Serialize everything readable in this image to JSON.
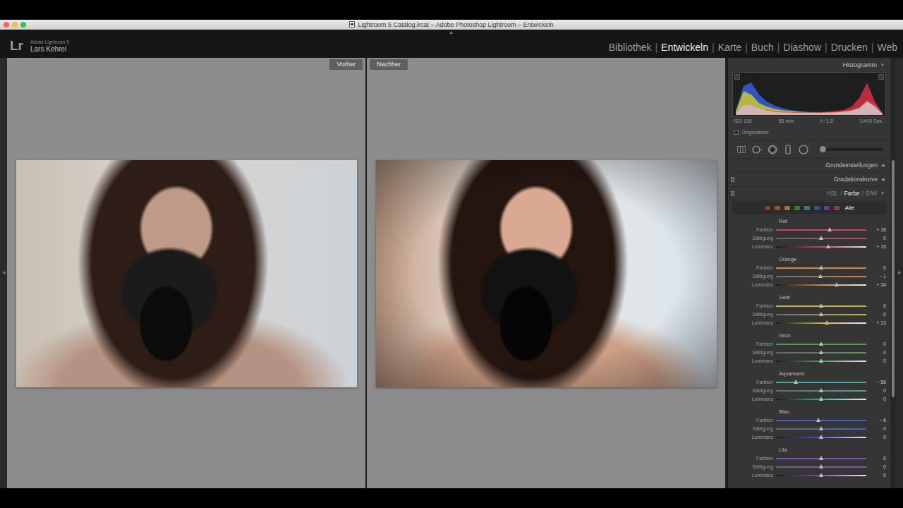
{
  "window": {
    "title": "Lightroom 5 Catalog.lrcat – Adobe Photoshop Lightroom – Entwickeln"
  },
  "app": {
    "logo": "Lr",
    "product": "Adobe Lightroom 5",
    "user": "Lars Kehrel"
  },
  "edges": {
    "top": "▲",
    "left": "◀",
    "right": "▶"
  },
  "module_separator": "|",
  "modules": [
    {
      "label": "Bibliothek",
      "selected": false
    },
    {
      "label": "Entwickeln",
      "selected": true
    },
    {
      "label": "Karte",
      "selected": false
    },
    {
      "label": "Buch",
      "selected": false
    },
    {
      "label": "Diashow",
      "selected": false
    },
    {
      "label": "Drucken",
      "selected": false
    },
    {
      "label": "Web",
      "selected": false
    }
  ],
  "compare": {
    "before": "Vorher",
    "after": "Nachher"
  },
  "histogram": {
    "title": "Histogramm",
    "toggle": "▼",
    "series": [
      {
        "color": "#3563e8",
        "values": [
          0.15,
          0.85,
          0.95,
          0.6,
          0.4,
          0.28,
          0.2,
          0.15,
          0.12,
          0.1,
          0.09,
          0.08,
          0.08,
          0.09,
          0.1,
          0.12,
          0.15,
          0.25,
          0.3,
          0.05
        ]
      },
      {
        "color": "#d8d020",
        "values": [
          0.1,
          0.7,
          0.6,
          0.35,
          0.25,
          0.18,
          0.14,
          0.12,
          0.1,
          0.09,
          0.08,
          0.08,
          0.09,
          0.1,
          0.12,
          0.15,
          0.22,
          0.45,
          0.3,
          0.05
        ]
      },
      {
        "color": "#e03048",
        "values": [
          0.05,
          0.3,
          0.3,
          0.2,
          0.15,
          0.12,
          0.1,
          0.09,
          0.08,
          0.08,
          0.08,
          0.09,
          0.1,
          0.12,
          0.15,
          0.25,
          0.5,
          0.95,
          0.4,
          0.05
        ]
      },
      {
        "color": "#d0d0d0",
        "values": [
          0.05,
          0.3,
          0.3,
          0.2,
          0.14,
          0.1,
          0.08,
          0.07,
          0.06,
          0.06,
          0.06,
          0.06,
          0.07,
          0.08,
          0.1,
          0.13,
          0.2,
          0.4,
          0.25,
          0.03
        ]
      }
    ],
    "info": [
      "ISO 100",
      "85 mm",
      "f / 1,8",
      "1/400 Sek."
    ],
    "original": {
      "label": "Originalfoto",
      "checked": false
    }
  },
  "tools": {
    "slider": {
      "level": 0.02
    }
  },
  "sections": [
    {
      "label": "Grundeinstellungen",
      "toggle": "◀",
      "kind": "plain"
    },
    {
      "label": "Gradationskurve",
      "toggle": "◀",
      "kind": "switch"
    }
  ],
  "hsl": {
    "tabs": [
      {
        "label": "HSL",
        "selected": false
      },
      {
        "label": "Farbe",
        "selected": true
      },
      {
        "label": "S/W",
        "selected": false
      }
    ],
    "separator": "/",
    "toggle": "▼",
    "swatches": [
      {
        "color": "#8a3a3a"
      },
      {
        "color": "#8a5a30"
      },
      {
        "color": "#8a8030"
      },
      {
        "color": "#3a7a3a"
      },
      {
        "color": "#3a7a7a"
      },
      {
        "color": "#3a4a9a"
      },
      {
        "color": "#6a3a8a"
      },
      {
        "color": "#8a3a6a"
      }
    ],
    "all": {
      "label": "Alle",
      "selected": true
    },
    "groups": [
      {
        "name": "Rot",
        "color": "#d4405a",
        "sliders": [
          {
            "label": "Farbton",
            "value": "+ 18",
            "level": 0.59
          },
          {
            "label": "Sättigung",
            "value": "0",
            "level": 0.5
          },
          {
            "label": "Luminanz",
            "value": "+ 15",
            "level": 0.575
          }
        ]
      },
      {
        "name": "Orange",
        "color": "#d8863a",
        "sliders": [
          {
            "label": "Farbton",
            "value": "0",
            "level": 0.5
          },
          {
            "label": "Sättigung",
            "value": "− 1",
            "level": 0.495
          },
          {
            "label": "Luminanz",
            "value": "+ 34",
            "level": 0.67
          }
        ]
      },
      {
        "name": "Gelb",
        "color": "#c8b83a",
        "sliders": [
          {
            "label": "Farbton",
            "value": "0",
            "level": 0.5
          },
          {
            "label": "Sättigung",
            "value": "0",
            "level": 0.5
          },
          {
            "label": "Luminanz",
            "value": "+ 13",
            "level": 0.565
          }
        ]
      },
      {
        "name": "Grün",
        "color": "#4aa050",
        "sliders": [
          {
            "label": "Farbton",
            "value": "0",
            "level": 0.5
          },
          {
            "label": "Sättigung",
            "value": "0",
            "level": 0.5
          },
          {
            "label": "Luminanz",
            "value": "0",
            "level": 0.5
          }
        ]
      },
      {
        "name": "Aquamarin",
        "color": "#3ab0a0",
        "sliders": [
          {
            "label": "Farbton",
            "value": "− 56",
            "level": 0.22
          },
          {
            "label": "Sättigung",
            "value": "0",
            "level": 0.5
          },
          {
            "label": "Luminanz",
            "value": "0",
            "level": 0.5
          }
        ]
      },
      {
        "name": "Blau",
        "color": "#4060d0",
        "sliders": [
          {
            "label": "Farbton",
            "value": "− 6",
            "level": 0.47
          },
          {
            "label": "Sättigung",
            "value": "0",
            "level": 0.5
          },
          {
            "label": "Luminanz",
            "value": "0",
            "level": 0.5
          }
        ]
      },
      {
        "name": "Lila",
        "color": "#8050c0",
        "sliders": [
          {
            "label": "Farbton",
            "value": "0",
            "level": 0.5
          },
          {
            "label": "Sättigung",
            "value": "0",
            "level": 0.5
          },
          {
            "label": "Luminanz",
            "value": "0",
            "level": 0.5
          }
        ]
      }
    ]
  },
  "scrollbar": {
    "level": 0.55
  }
}
